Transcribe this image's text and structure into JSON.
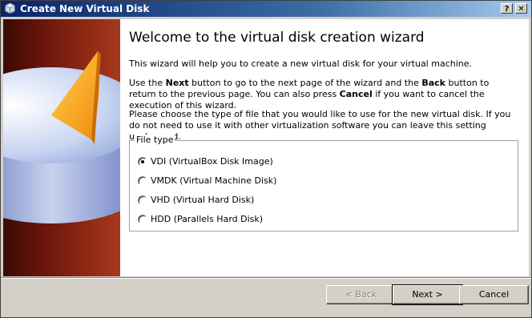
{
  "window": {
    "title": "Create New Virtual Disk",
    "help_label": "?",
    "close_label": "✕"
  },
  "main": {
    "heading": "Welcome to the virtual disk creation wizard",
    "intro": "This wizard will help you to create a new virtual disk for your virtual machine.",
    "nav_text": {
      "part1": "Use the ",
      "next_word": "Next",
      "part2": " button to go to the next page of the wizard and the ",
      "back_word": "Back",
      "part3": " button to return to the previous page. You can also press ",
      "cancel_word": "Cancel",
      "part4": " if you want to cancel the execution of this wizard."
    },
    "choose_text": "Please choose the type of file that you would like to use for the new virtual disk. If you do not need to use it with other virtualization software you can leave this setting unchanged."
  },
  "file_type": {
    "legend": "File type",
    "options": [
      {
        "label": "VDI (VirtualBox Disk Image)",
        "checked": true
      },
      {
        "label": "VMDK (Virtual Machine Disk)",
        "checked": false
      },
      {
        "label": "VHD (Virtual Hard Disk)",
        "checked": false
      },
      {
        "label": "HDD (Parallels Hard Disk)",
        "checked": false
      }
    ]
  },
  "buttons": {
    "back": "< Back",
    "next": "Next >",
    "cancel": "Cancel"
  },
  "icons": {
    "window": "virtualbox-icon",
    "banner": "disk-pie-graphic"
  },
  "colors": {
    "titlebar_start": "#0a246a",
    "sidebar": "#8e2814",
    "dialog_bg": "#d4d0c8"
  }
}
